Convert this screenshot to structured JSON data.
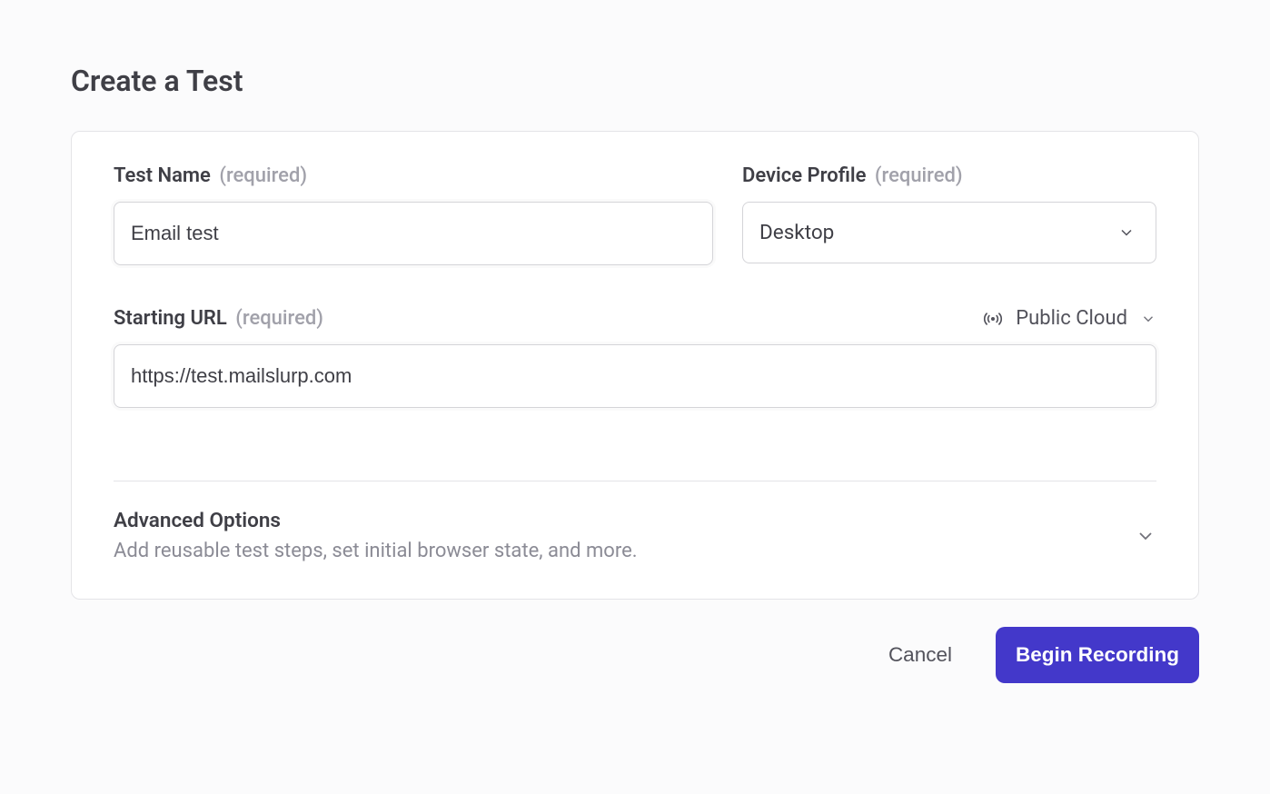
{
  "page_title": "Create a Test",
  "test_name": {
    "label": "Test Name",
    "required_hint": "(required)",
    "value": "Email test"
  },
  "device_profile": {
    "label": "Device Profile",
    "required_hint": "(required)",
    "selected": "Desktop"
  },
  "starting_url": {
    "label": "Starting URL",
    "required_hint": "(required)",
    "value": "https://test.mailslurp.com"
  },
  "environment": {
    "selected": "Public Cloud"
  },
  "advanced": {
    "title": "Advanced Options",
    "description": "Add reusable test steps, set initial browser state, and more."
  },
  "actions": {
    "cancel": "Cancel",
    "begin_recording": "Begin Recording"
  }
}
